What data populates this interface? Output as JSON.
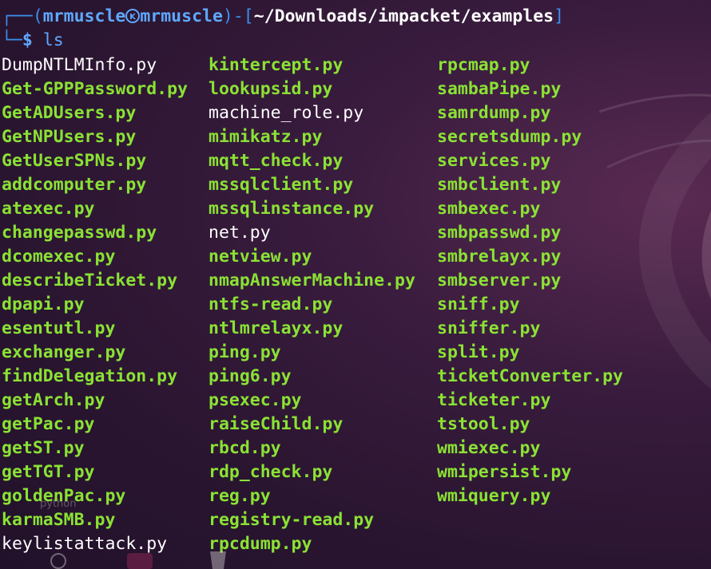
{
  "prompt": {
    "user": "mrmuscle",
    "host": "mrmuscle",
    "path": "~/Downloads/impacket/examples",
    "command": "ls"
  },
  "dock_hint_label": "python",
  "files": {
    "col1": [
      {
        "name": "DumpNTLMInfo.py",
        "exec": false
      },
      {
        "name": "Get-GPPPassword.py",
        "exec": true
      },
      {
        "name": "GetADUsers.py",
        "exec": true
      },
      {
        "name": "GetNPUsers.py",
        "exec": true
      },
      {
        "name": "GetUserSPNs.py",
        "exec": true
      },
      {
        "name": "addcomputer.py",
        "exec": true
      },
      {
        "name": "atexec.py",
        "exec": true
      },
      {
        "name": "changepasswd.py",
        "exec": true
      },
      {
        "name": "dcomexec.py",
        "exec": true
      },
      {
        "name": "describeTicket.py",
        "exec": true
      },
      {
        "name": "dpapi.py",
        "exec": true
      },
      {
        "name": "esentutl.py",
        "exec": true
      },
      {
        "name": "exchanger.py",
        "exec": true
      },
      {
        "name": "findDelegation.py",
        "exec": true
      },
      {
        "name": "getArch.py",
        "exec": true
      },
      {
        "name": "getPac.py",
        "exec": true
      },
      {
        "name": "getST.py",
        "exec": true
      },
      {
        "name": "getTGT.py",
        "exec": true
      },
      {
        "name": "goldenPac.py",
        "exec": true
      },
      {
        "name": "karmaSMB.py",
        "exec": true
      },
      {
        "name": "keylistattack.py",
        "exec": false
      }
    ],
    "col2": [
      {
        "name": "kintercept.py",
        "exec": true
      },
      {
        "name": "lookupsid.py",
        "exec": true
      },
      {
        "name": "machine_role.py",
        "exec": false
      },
      {
        "name": "mimikatz.py",
        "exec": true
      },
      {
        "name": "mqtt_check.py",
        "exec": true
      },
      {
        "name": "mssqlclient.py",
        "exec": true
      },
      {
        "name": "mssqlinstance.py",
        "exec": true
      },
      {
        "name": "net.py",
        "exec": false
      },
      {
        "name": "netview.py",
        "exec": true
      },
      {
        "name": "nmapAnswerMachine.py",
        "exec": true
      },
      {
        "name": "ntfs-read.py",
        "exec": true
      },
      {
        "name": "ntlmrelayx.py",
        "exec": true
      },
      {
        "name": "ping.py",
        "exec": true
      },
      {
        "name": "ping6.py",
        "exec": true
      },
      {
        "name": "psexec.py",
        "exec": true
      },
      {
        "name": "raiseChild.py",
        "exec": true
      },
      {
        "name": "rbcd.py",
        "exec": true
      },
      {
        "name": "rdp_check.py",
        "exec": true
      },
      {
        "name": "reg.py",
        "exec": true
      },
      {
        "name": "registry-read.py",
        "exec": true
      },
      {
        "name": "rpcdump.py",
        "exec": true
      }
    ],
    "col3": [
      {
        "name": "rpcmap.py",
        "exec": true
      },
      {
        "name": "sambaPipe.py",
        "exec": true
      },
      {
        "name": "samrdump.py",
        "exec": true
      },
      {
        "name": "secretsdump.py",
        "exec": true
      },
      {
        "name": "services.py",
        "exec": true
      },
      {
        "name": "smbclient.py",
        "exec": true
      },
      {
        "name": "smbexec.py",
        "exec": true
      },
      {
        "name": "smbpasswd.py",
        "exec": true
      },
      {
        "name": "smbrelayx.py",
        "exec": true
      },
      {
        "name": "smbserver.py",
        "exec": true
      },
      {
        "name": "sniff.py",
        "exec": true
      },
      {
        "name": "sniffer.py",
        "exec": true
      },
      {
        "name": "split.py",
        "exec": true
      },
      {
        "name": "ticketConverter.py",
        "exec": true
      },
      {
        "name": "ticketer.py",
        "exec": true
      },
      {
        "name": "tstool.py",
        "exec": true
      },
      {
        "name": "wmiexec.py",
        "exec": true
      },
      {
        "name": "wmipersist.py",
        "exec": true
      },
      {
        "name": "wmiquery.py",
        "exec": true
      }
    ]
  },
  "colors": {
    "exec_file": "#8ae234",
    "plain_file": "#ffffff",
    "prompt": "#5fa8ff",
    "box": "#3b8eea"
  }
}
